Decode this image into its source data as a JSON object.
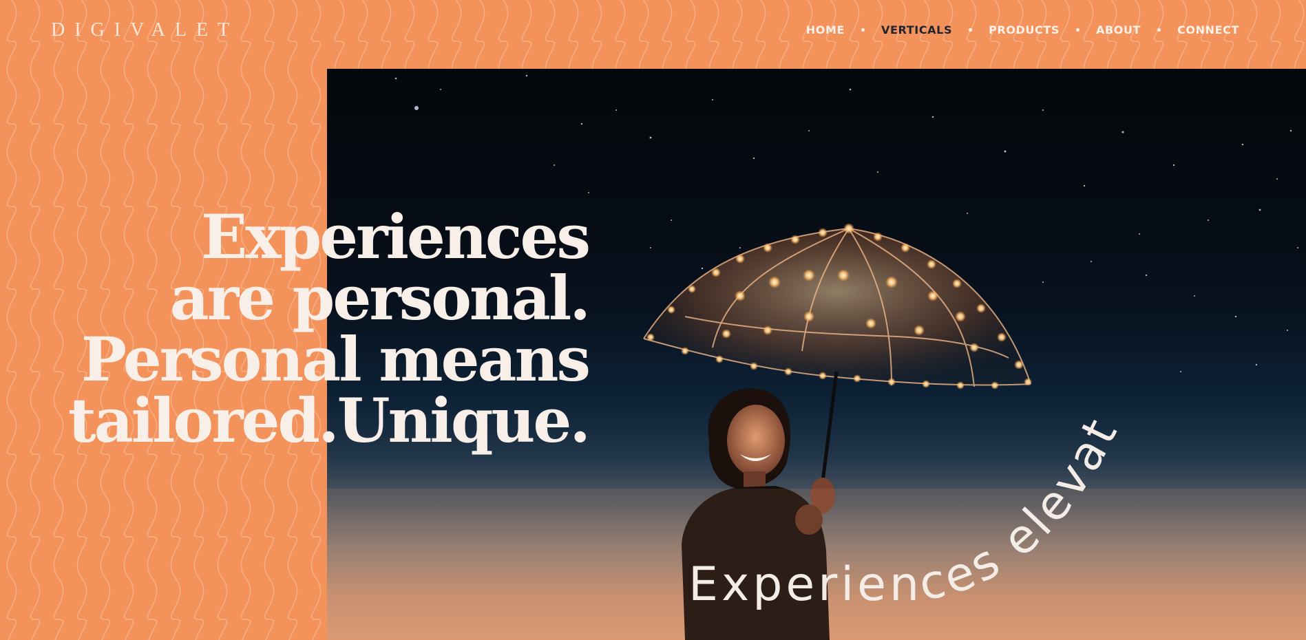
{
  "header": {
    "logo": "DIGIVALET",
    "nav": [
      {
        "label": "HOME",
        "active": false
      },
      {
        "label": "VERTICALS",
        "active": true
      },
      {
        "label": "PRODUCTS",
        "active": false
      },
      {
        "label": "ABOUT",
        "active": false
      },
      {
        "label": "CONNECT",
        "active": false
      }
    ]
  },
  "hero": {
    "headline_lines": [
      "Experiences",
      "are personal.",
      "Personal means",
      "tailored.Unique."
    ],
    "tagline": "Experiences elevated",
    "image_icon": "woman-with-light-umbrella-photo"
  },
  "colors": {
    "brand_orange": "#f4925c",
    "text_cream": "#f7efe8",
    "nav_active": "#1f2430"
  }
}
